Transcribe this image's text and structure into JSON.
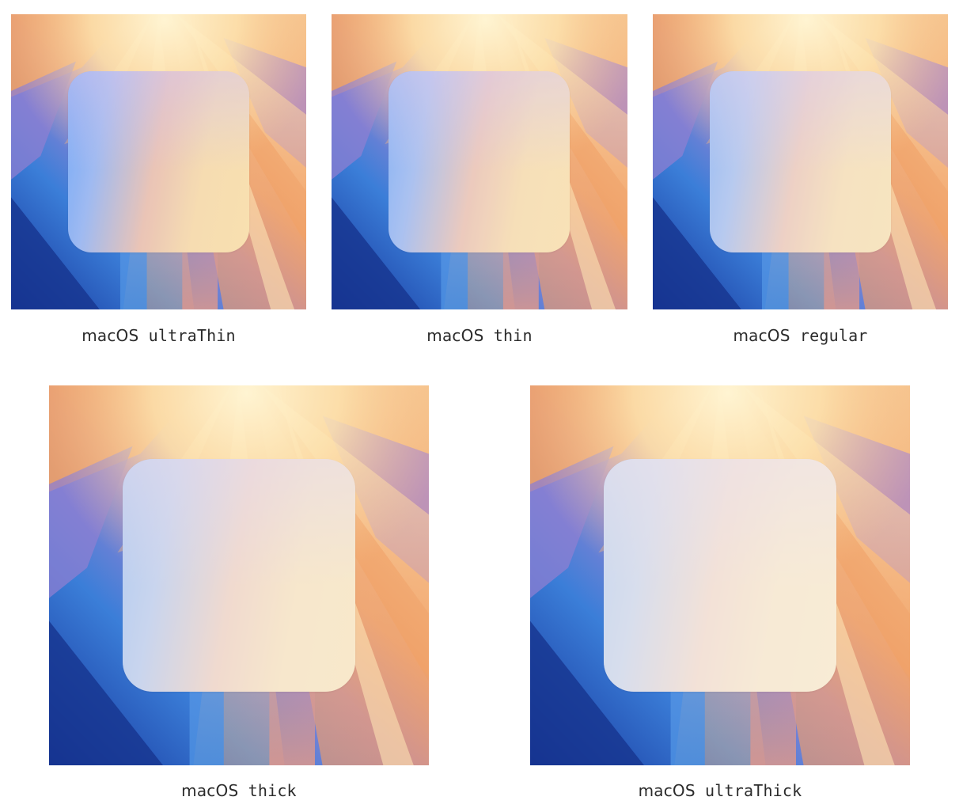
{
  "samples": [
    {
      "id": "ultraThin",
      "caption_prefix": "macOS",
      "caption_name": "ultraThin",
      "frost_opacity": 0.05
    },
    {
      "id": "thin",
      "caption_prefix": "macOS",
      "caption_name": "thin",
      "frost_opacity": 0.18
    },
    {
      "id": "regular",
      "caption_prefix": "macOS",
      "caption_name": "regular",
      "frost_opacity": 0.32
    },
    {
      "id": "thick",
      "caption_prefix": "macOS",
      "caption_name": "thick",
      "frost_opacity": 0.5
    },
    {
      "id": "ultraThick",
      "caption_prefix": "macOS",
      "caption_name": "ultraThick",
      "frost_opacity": 0.66
    }
  ],
  "colors": {
    "background": "#ffffff",
    "caption": "#2b2b2b",
    "wallpaper_blue_deep": "#1e3fa8",
    "wallpaper_blue": "#3a7bd8",
    "wallpaper_purple": "#9b7fd0",
    "wallpaper_orange": "#f0a066",
    "wallpaper_cream": "#fbe3b0"
  }
}
